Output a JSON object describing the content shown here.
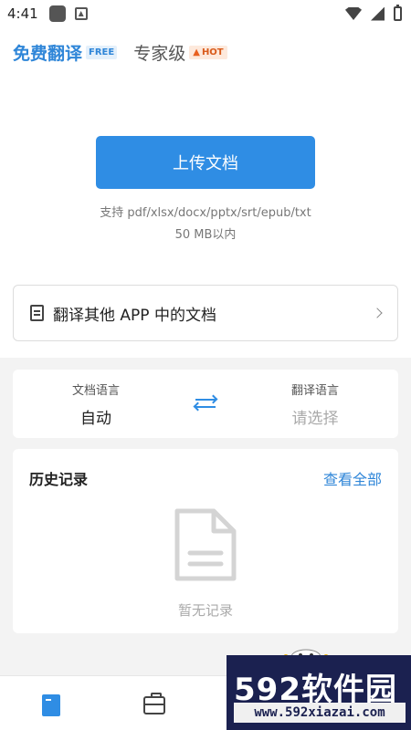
{
  "status_bar": {
    "time": "4:41"
  },
  "tabs": [
    {
      "label": "免费翻译",
      "badge": "FREE"
    },
    {
      "label": "专家级",
      "badge": "HOT"
    }
  ],
  "upload": {
    "button_label": "上传文档",
    "formats": "支持 pdf/xlsx/docx/pptx/srt/epub/txt",
    "size_limit": "50 MB以内"
  },
  "other_app": {
    "label": "翻译其他 APP 中的文档"
  },
  "language": {
    "source_title": "文档语言",
    "source_value": "自动",
    "target_title": "翻译语言",
    "target_placeholder": "请选择"
  },
  "history": {
    "title": "历史记录",
    "view_all": "查看全部",
    "empty_text": "暂无记录"
  },
  "watermark": {
    "title": "592软件园",
    "url": "www.592xiazai.com"
  },
  "colors": {
    "accent": "#2f8de4",
    "hot": "#d95b1b",
    "watermark_bg": "#1b2150"
  }
}
